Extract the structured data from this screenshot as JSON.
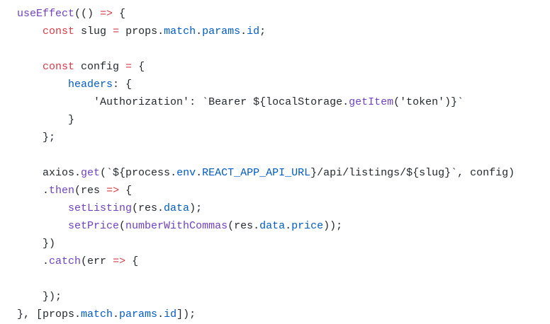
{
  "editor": {
    "colors": {
      "background": "#ffffff",
      "plain": "#24292e",
      "keyword": "#d73a49",
      "function": "#6f42c1",
      "property": "#005cc5"
    },
    "lines": [
      {
        "indent": "",
        "tokens": [
          {
            "t": "useEffect",
            "k": "fn"
          },
          {
            "t": "(() ",
            "k": "plain"
          },
          {
            "t": "=>",
            "k": "op"
          },
          {
            "t": " {",
            "k": "plain"
          }
        ]
      },
      {
        "indent": "    ",
        "tokens": [
          {
            "t": "const",
            "k": "kw"
          },
          {
            "t": " slug ",
            "k": "plain"
          },
          {
            "t": "=",
            "k": "op"
          },
          {
            "t": " props.",
            "k": "plain"
          },
          {
            "t": "match",
            "k": "prop"
          },
          {
            "t": ".",
            "k": "plain"
          },
          {
            "t": "params",
            "k": "prop"
          },
          {
            "t": ".",
            "k": "plain"
          },
          {
            "t": "id",
            "k": "prop"
          },
          {
            "t": ";",
            "k": "plain"
          }
        ]
      },
      {
        "indent": "",
        "tokens": []
      },
      {
        "indent": "    ",
        "tokens": [
          {
            "t": "const",
            "k": "kw"
          },
          {
            "t": " config ",
            "k": "plain"
          },
          {
            "t": "=",
            "k": "op"
          },
          {
            "t": " {",
            "k": "plain"
          }
        ]
      },
      {
        "indent": "        ",
        "tokens": [
          {
            "t": "headers",
            "k": "prop"
          },
          {
            "t": ": {",
            "k": "plain"
          }
        ]
      },
      {
        "indent": "            ",
        "tokens": [
          {
            "t": "'Authorization'",
            "k": "str"
          },
          {
            "t": ": ",
            "k": "plain"
          },
          {
            "t": "`Bearer ${localStorage.",
            "k": "str"
          },
          {
            "t": "getItem",
            "k": "fn"
          },
          {
            "t": "('token')}`",
            "k": "str"
          }
        ]
      },
      {
        "indent": "        ",
        "tokens": [
          {
            "t": "}",
            "k": "plain"
          }
        ]
      },
      {
        "indent": "    ",
        "tokens": [
          {
            "t": "};",
            "k": "plain"
          }
        ]
      },
      {
        "indent": "",
        "tokens": []
      },
      {
        "indent": "    ",
        "tokens": [
          {
            "t": "axios.",
            "k": "plain"
          },
          {
            "t": "get",
            "k": "fn"
          },
          {
            "t": "(`${process.",
            "k": "plain"
          },
          {
            "t": "env",
            "k": "prop"
          },
          {
            "t": ".",
            "k": "plain"
          },
          {
            "t": "REACT_APP_API_URL",
            "k": "prop"
          },
          {
            "t": "}/api/listings/${slug}`, config)",
            "k": "plain"
          }
        ]
      },
      {
        "indent": "    ",
        "tokens": [
          {
            "t": ".",
            "k": "plain"
          },
          {
            "t": "then",
            "k": "fn"
          },
          {
            "t": "(res ",
            "k": "plain"
          },
          {
            "t": "=>",
            "k": "op"
          },
          {
            "t": " {",
            "k": "plain"
          }
        ]
      },
      {
        "indent": "        ",
        "tokens": [
          {
            "t": "setListing",
            "k": "fn"
          },
          {
            "t": "(res.",
            "k": "plain"
          },
          {
            "t": "data",
            "k": "prop"
          },
          {
            "t": ");",
            "k": "plain"
          }
        ]
      },
      {
        "indent": "        ",
        "tokens": [
          {
            "t": "setPrice",
            "k": "fn"
          },
          {
            "t": "(",
            "k": "plain"
          },
          {
            "t": "numberWithCommas",
            "k": "fn"
          },
          {
            "t": "(res.",
            "k": "plain"
          },
          {
            "t": "data",
            "k": "prop"
          },
          {
            "t": ".",
            "k": "plain"
          },
          {
            "t": "price",
            "k": "prop"
          },
          {
            "t": "));",
            "k": "plain"
          }
        ]
      },
      {
        "indent": "    ",
        "tokens": [
          {
            "t": "})",
            "k": "plain"
          }
        ]
      },
      {
        "indent": "    ",
        "tokens": [
          {
            "t": ".",
            "k": "plain"
          },
          {
            "t": "catch",
            "k": "fn"
          },
          {
            "t": "(err ",
            "k": "plain"
          },
          {
            "t": "=>",
            "k": "op"
          },
          {
            "t": " {",
            "k": "plain"
          }
        ]
      },
      {
        "indent": "",
        "tokens": []
      },
      {
        "indent": "    ",
        "tokens": [
          {
            "t": "});",
            "k": "plain"
          }
        ]
      },
      {
        "indent": "",
        "tokens": [
          {
            "t": "}, [props.",
            "k": "plain"
          },
          {
            "t": "match",
            "k": "prop"
          },
          {
            "t": ".",
            "k": "plain"
          },
          {
            "t": "params",
            "k": "prop"
          },
          {
            "t": ".",
            "k": "plain"
          },
          {
            "t": "id",
            "k": "prop"
          },
          {
            "t": "]);",
            "k": "plain"
          }
        ]
      }
    ]
  }
}
